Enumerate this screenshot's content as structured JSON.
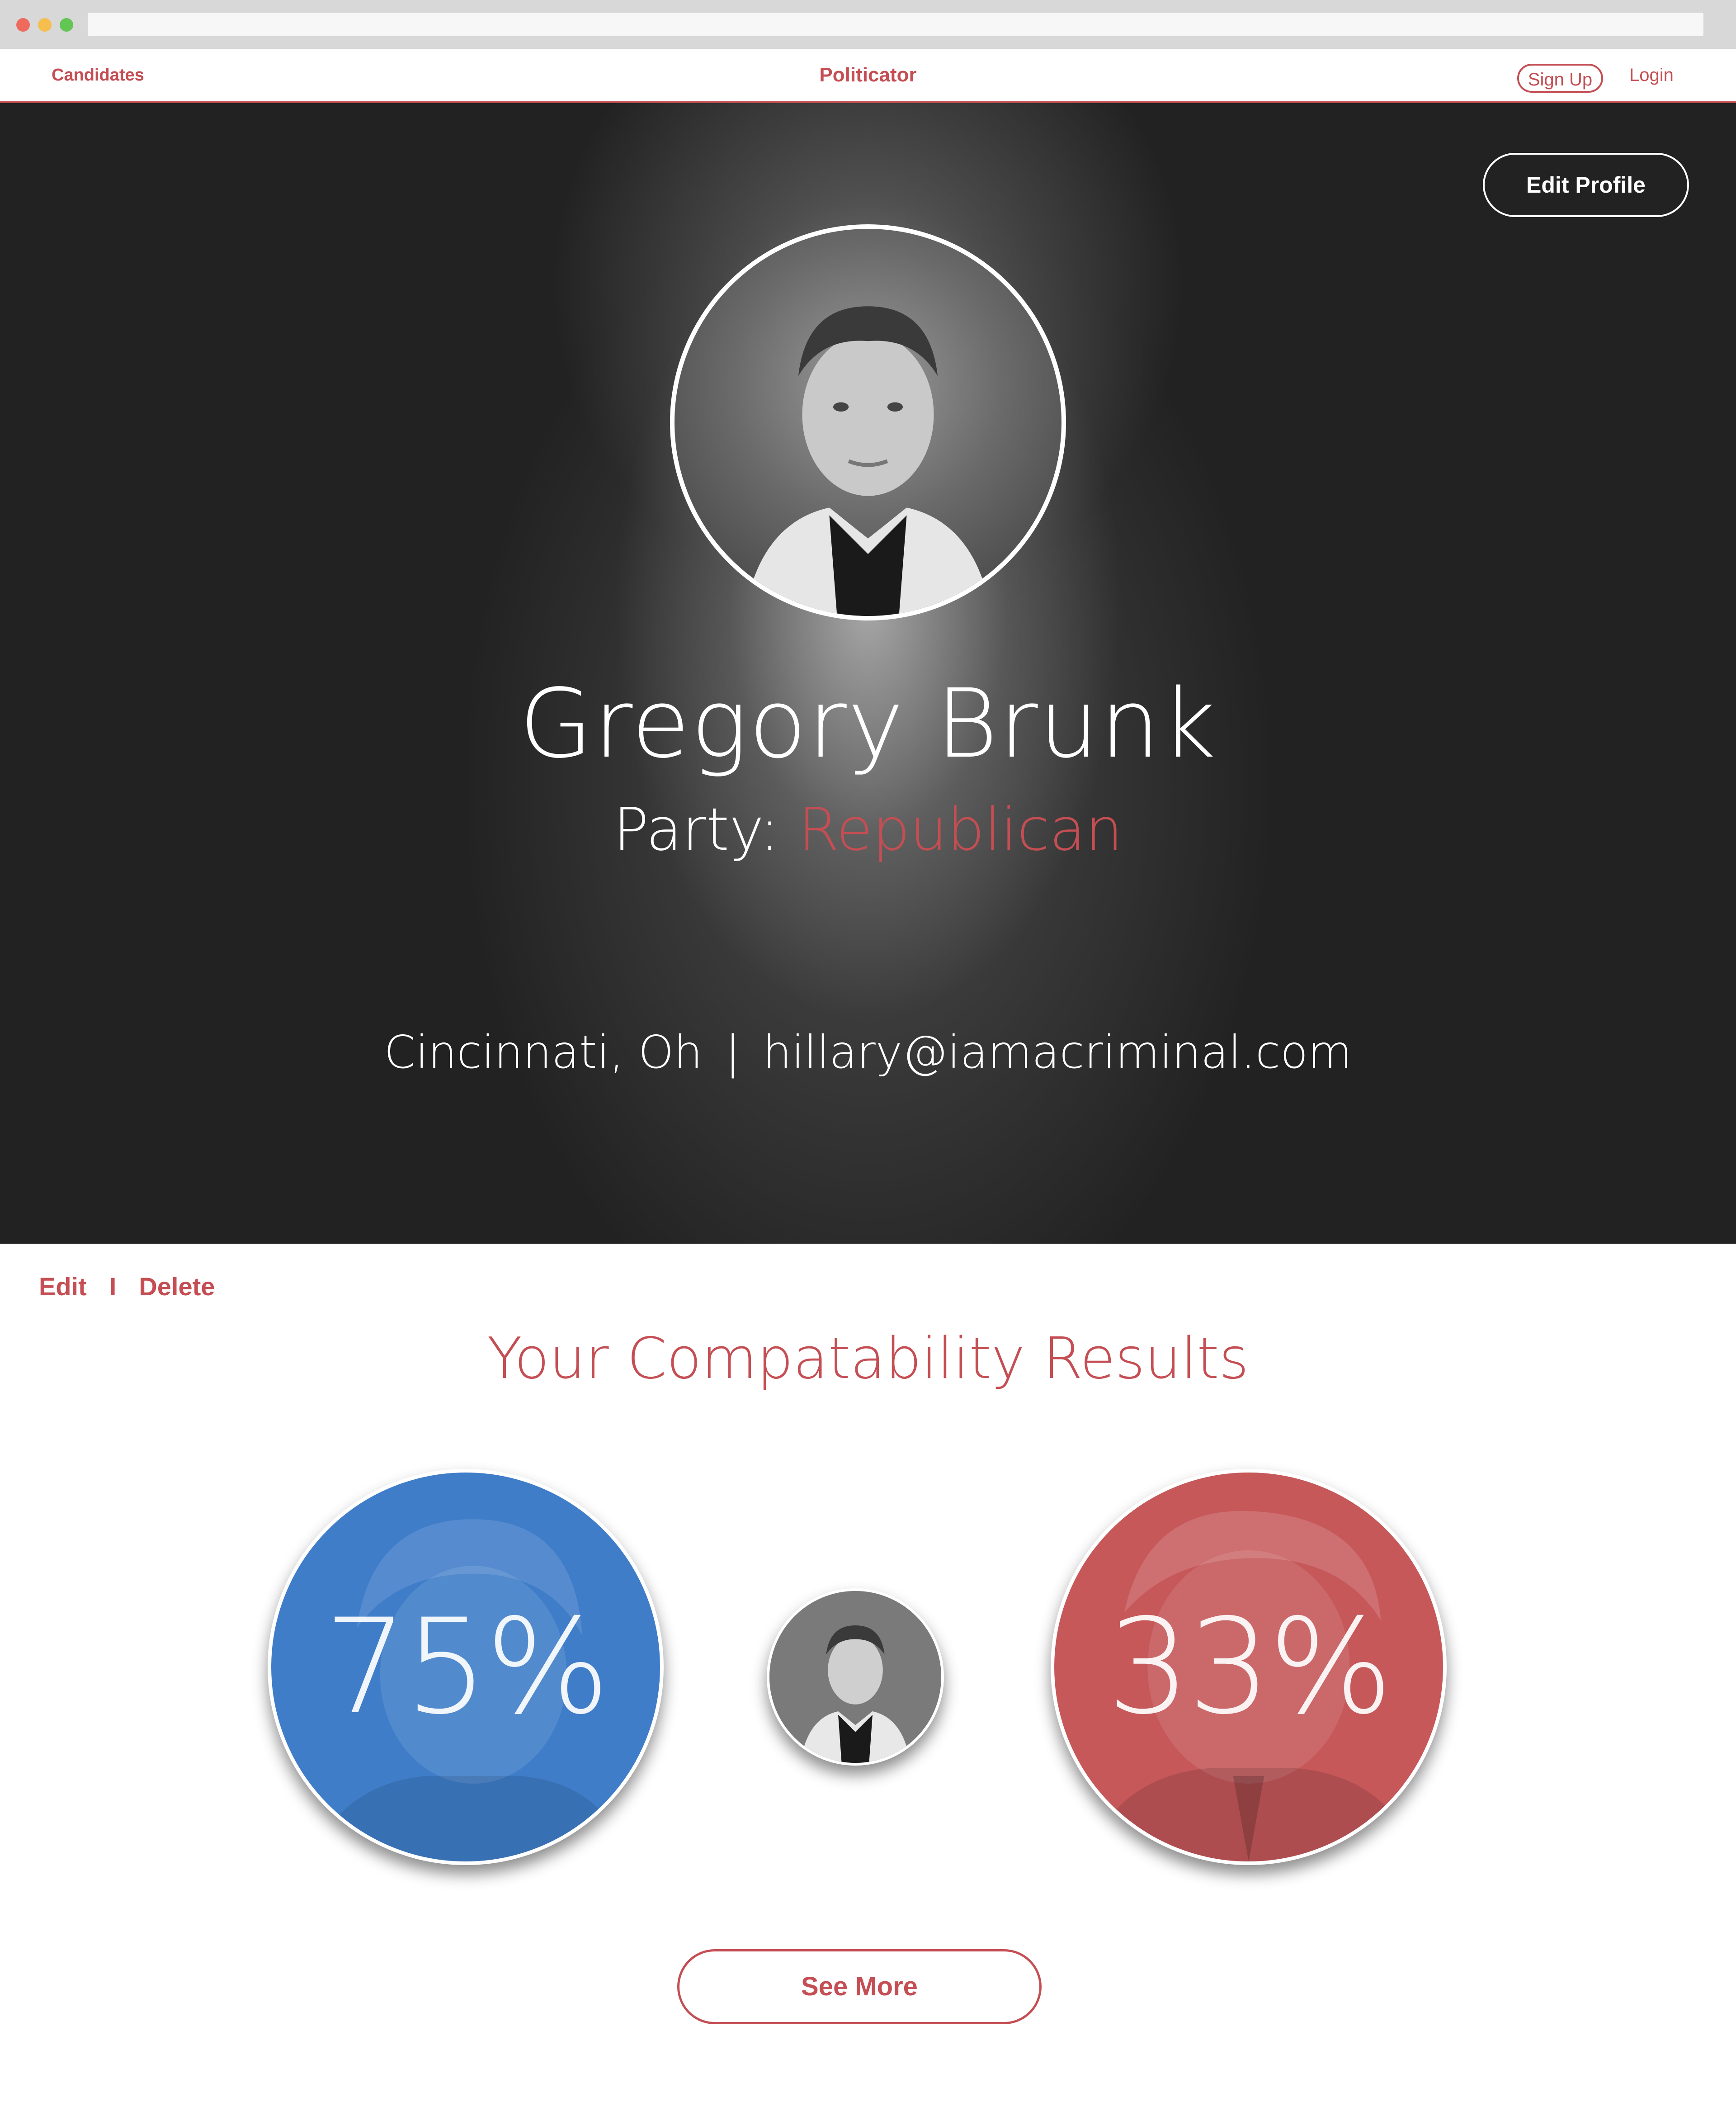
{
  "nav": {
    "candidates": "Candidates",
    "brand": "Politicator",
    "signup": "Sign Up",
    "login": "Login"
  },
  "hero": {
    "edit_profile": "Edit Profile",
    "name": "Gregory Brunk",
    "party_label": "Party:",
    "party_value": "Republican",
    "location": "Cincinnati, Oh",
    "separator": "|",
    "email": "hillary@iamacriminal.com"
  },
  "admin": {
    "edit": "Edit",
    "separator": "I",
    "delete": "Delete"
  },
  "results": {
    "title": "Your Compatability Results",
    "left_percent": "75%",
    "right_percent": "33%",
    "see_more": "See More"
  },
  "colors": {
    "accent": "#c44e53",
    "blue_candidate": "#3f7dc9",
    "red_candidate": "#c6585a"
  }
}
